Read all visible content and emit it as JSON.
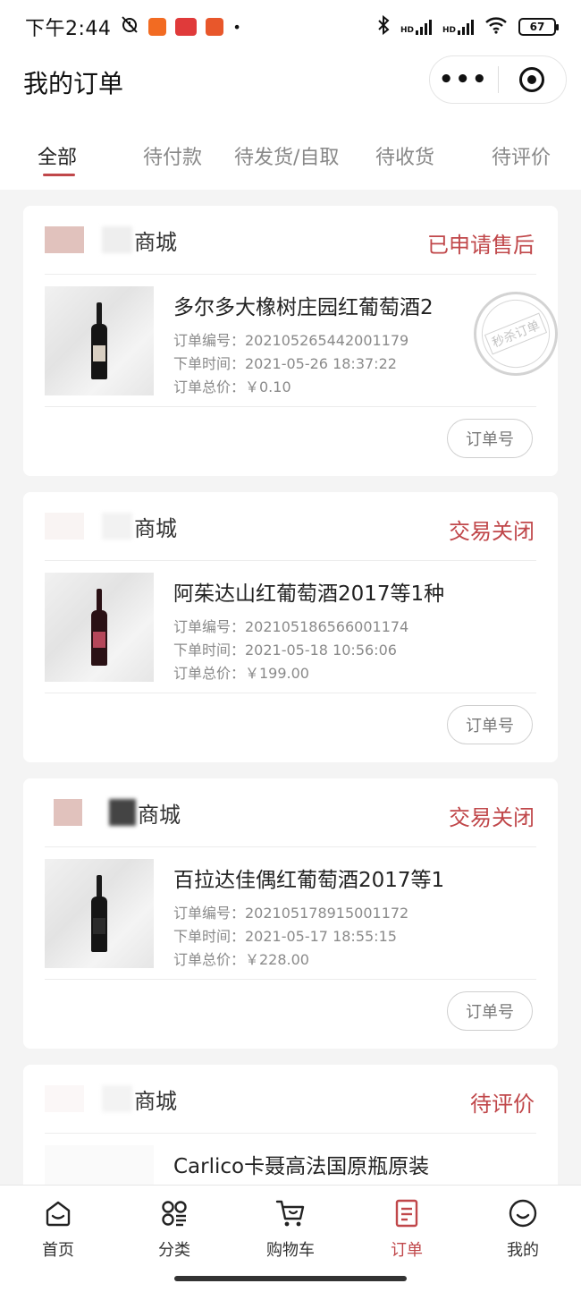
{
  "status_bar": {
    "time": "下午2:44",
    "battery": "67",
    "hd1": "HD",
    "hd2": "HD"
  },
  "nav": {
    "title": "我的订单",
    "more": "•••"
  },
  "tabs": [
    {
      "label": "全部"
    },
    {
      "label": "待付款"
    },
    {
      "label": "待发货/自取"
    },
    {
      "label": "待收货"
    },
    {
      "label": "待评价"
    }
  ],
  "orders": [
    {
      "shop": "商城",
      "status": "已申请售后",
      "product": "多尔多大橡树庄园红葡萄酒2",
      "order_no": "订单编号：202105265442001179",
      "order_time": "下单时间：2021-05-26 18:37:22",
      "total": "订单总价：￥0.10",
      "button": "订单号",
      "stamp": "秒杀订单"
    },
    {
      "shop": "商城",
      "status": "交易关闭",
      "product": "阿茱达山红葡萄酒2017等1种",
      "order_no": "订单编号：202105186566001174",
      "order_time": "下单时间：2021-05-18 10:56:06",
      "total": "订单总价：￥199.00",
      "button": "订单号"
    },
    {
      "shop": "商城",
      "status": "交易关闭",
      "product": "百拉达佳偶红葡萄酒2017等1",
      "order_no": "订单编号：202105178915001172",
      "order_time": "下单时间：2021-05-17 18:55:15",
      "total": "订单总价：￥228.00",
      "button": "订单号"
    },
    {
      "shop": "商城",
      "status": "待评价",
      "product": "Carlico卡聂高法国原瓶原装"
    }
  ],
  "tabbar": [
    {
      "label": "首页",
      "icon": "home-icon"
    },
    {
      "label": "分类",
      "icon": "category-icon"
    },
    {
      "label": "购物车",
      "icon": "cart-icon"
    },
    {
      "label": "订单",
      "icon": "order-icon"
    },
    {
      "label": "我的",
      "icon": "profile-icon"
    }
  ],
  "colors": {
    "accent": "#c0474a",
    "background": "#f4f4f4"
  }
}
